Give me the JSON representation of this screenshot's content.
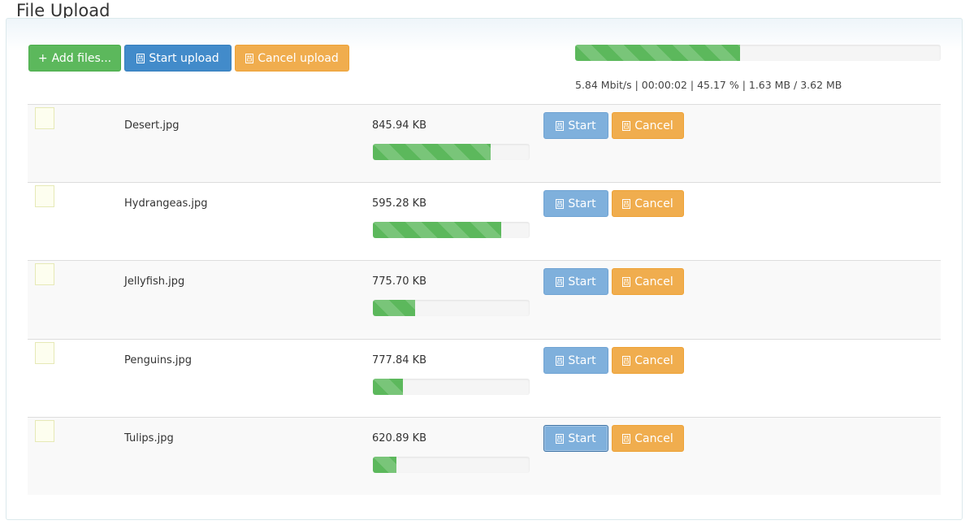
{
  "page": {
    "title": "File Upload"
  },
  "toolbar": {
    "add_label": "Add files...",
    "add_icon": "plus-icon",
    "start_label": "Start upload",
    "start_icon": "upload-icon",
    "cancel_label": "Cancel upload",
    "cancel_icon": "ban-icon"
  },
  "overall": {
    "progress_percent": 45.17,
    "stats": "5.84 Mbit/s | 00:00:02 | 45.17 % | 1.63 MB / 3.62 MB"
  },
  "colors": {
    "success": "#5cb85c",
    "primary": "#428bca",
    "warning": "#f0ad4e"
  },
  "files": [
    {
      "name": "Desert.jpg",
      "size": "845.94 KB",
      "progress_percent": 75,
      "start_label": "Start",
      "cancel_label": "Cancel"
    },
    {
      "name": "Hydrangeas.jpg",
      "size": "595.28 KB",
      "progress_percent": 82,
      "start_label": "Start",
      "cancel_label": "Cancel"
    },
    {
      "name": "Jellyfish.jpg",
      "size": "775.70 KB",
      "progress_percent": 27,
      "start_label": "Start",
      "cancel_label": "Cancel"
    },
    {
      "name": "Penguins.jpg",
      "size": "777.84 KB",
      "progress_percent": 19,
      "start_label": "Start",
      "cancel_label": "Cancel"
    },
    {
      "name": "Tulips.jpg",
      "size": "620.89 KB",
      "progress_percent": 15,
      "start_label": "Start",
      "cancel_label": "Cancel"
    }
  ]
}
